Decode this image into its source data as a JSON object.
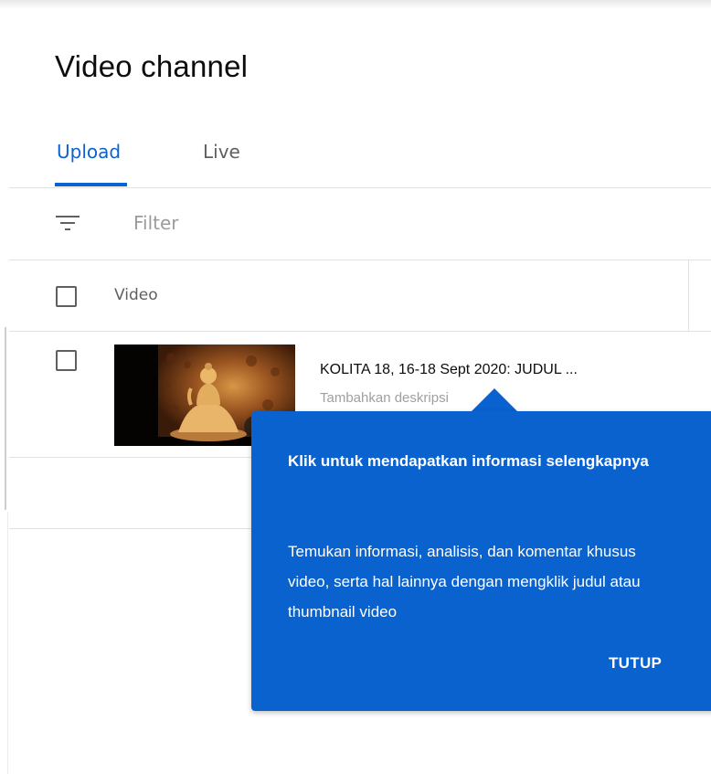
{
  "page": {
    "title": "Video channel"
  },
  "tabs": [
    {
      "label": "Upload",
      "active": true
    },
    {
      "label": "Live",
      "active": false
    }
  ],
  "filter": {
    "placeholder": "Filter"
  },
  "table": {
    "columns": [
      "Video"
    ],
    "rows": [
      {
        "title": "KOLITA 18, 16-18 Sept 2020: JUDUL ...",
        "description": "Tambahkan deskripsi",
        "checked": false
      }
    ]
  },
  "tooltip": {
    "heading": "Klik untuk mendapatkan informasi selengkapnya",
    "body": "Temukan informasi, analisis, dan komentar khusus video, serta hal lainnya dengan mengklik judul atau thumbnail video",
    "close_label": "TUTUP"
  },
  "colors": {
    "accent": "#0b62d0",
    "tooltip_bg": "#0a62cf",
    "text_primary": "#0d0d0d",
    "text_secondary": "#606060",
    "divider": "#e2e2e2"
  },
  "icons": {
    "filter": "filter-icon",
    "checkbox": "checkbox-icon"
  }
}
